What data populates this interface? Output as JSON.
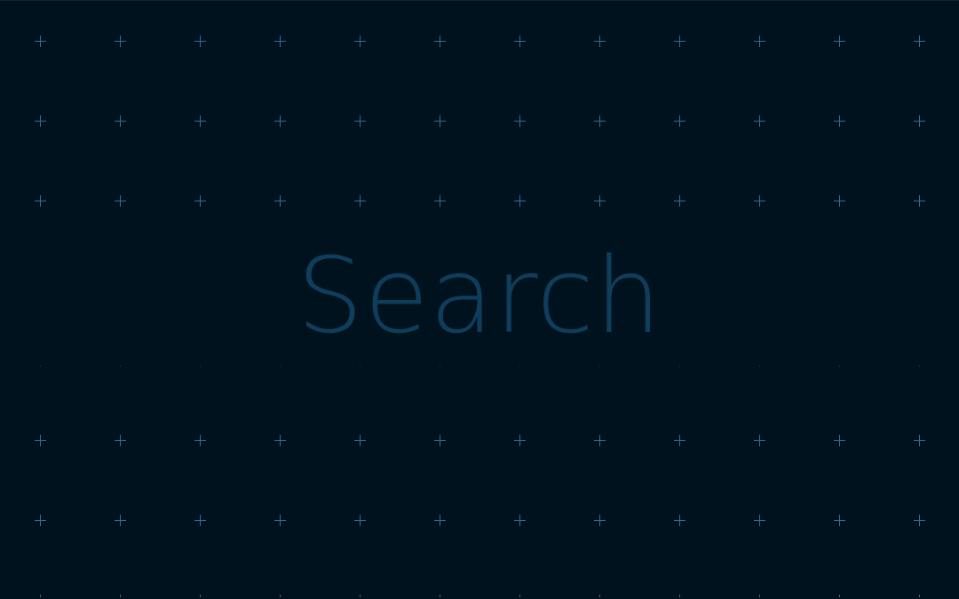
{
  "search": {
    "placeholder": "Search",
    "value": ""
  },
  "colors": {
    "background": "#00121d",
    "grid_mark": "#2d6f99",
    "placeholder_text": "#0f3d5c"
  },
  "icons": {
    "grid_marker": "plus-cross"
  }
}
